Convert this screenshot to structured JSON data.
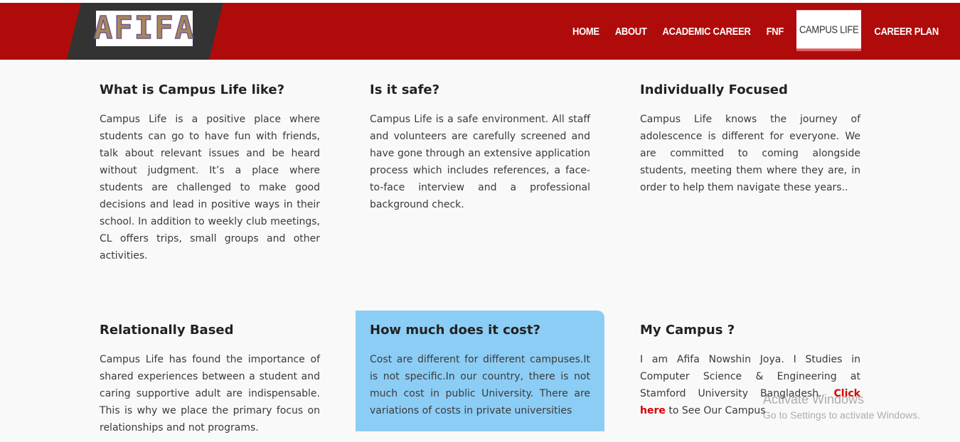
{
  "brand": {
    "logo_text": "AFIFA"
  },
  "nav": {
    "items": [
      {
        "label": "HOME"
      },
      {
        "label": "ABOUT"
      },
      {
        "label": "ACADEMIC CAREER"
      },
      {
        "label": "FNF"
      },
      {
        "label": "CAMPUS LIFE",
        "active": true
      },
      {
        "label": "CAREER PLAN"
      }
    ]
  },
  "cards": [
    {
      "title": "What is Campus Life like?",
      "body": "Campus Life is a positive place where students can go to have fun with friends, talk about relevant issues and be heard without judgment. It’s a place where students are challenged to make good decisions and lead in positive ways in their school. In addition to weekly club meetings, CL offers trips, small groups and other activities."
    },
    {
      "title": "Is it safe?",
      "body": "Campus Life is a safe environment. All staff and volunteers are carefully screened and have gone through an extensive application process which includes references, a face-to-face interview and a professional background check."
    },
    {
      "title": "Individually Focused",
      "body": "Campus Life knows the journey of adolescence is different for everyone. We are committed to coming alongside students, meeting them where they are, in order to help them navigate these years.."
    },
    {
      "title": "Relationally Based",
      "body": "Campus Life has found the importance of shared experiences between a student and caring supportive adult are indispensable. This is why we place the primary focus on relationships and not programs."
    },
    {
      "title": "How much does it cost?",
      "body": "Cost are different for different campuses.It is not specific.In our country, there is not much cost in public University. There are variations of costs in private universities"
    },
    {
      "title": "My Campus ?",
      "body_before": "I am Afifa Nowshin Joya. I Studies in Computer Science & Engineering at Stamford University Bangladesh.",
      "link_label": "Click here",
      "body_after": "to See Our Campus"
    }
  ],
  "watermark": {
    "line1": "Activate Windows",
    "line2": "Go to Settings to activate Windows."
  },
  "colors": {
    "header_red": "#b00b0b",
    "logo_band": "#333333",
    "highlight_blue": "#8ccdf5",
    "link_red": "#d40000"
  }
}
